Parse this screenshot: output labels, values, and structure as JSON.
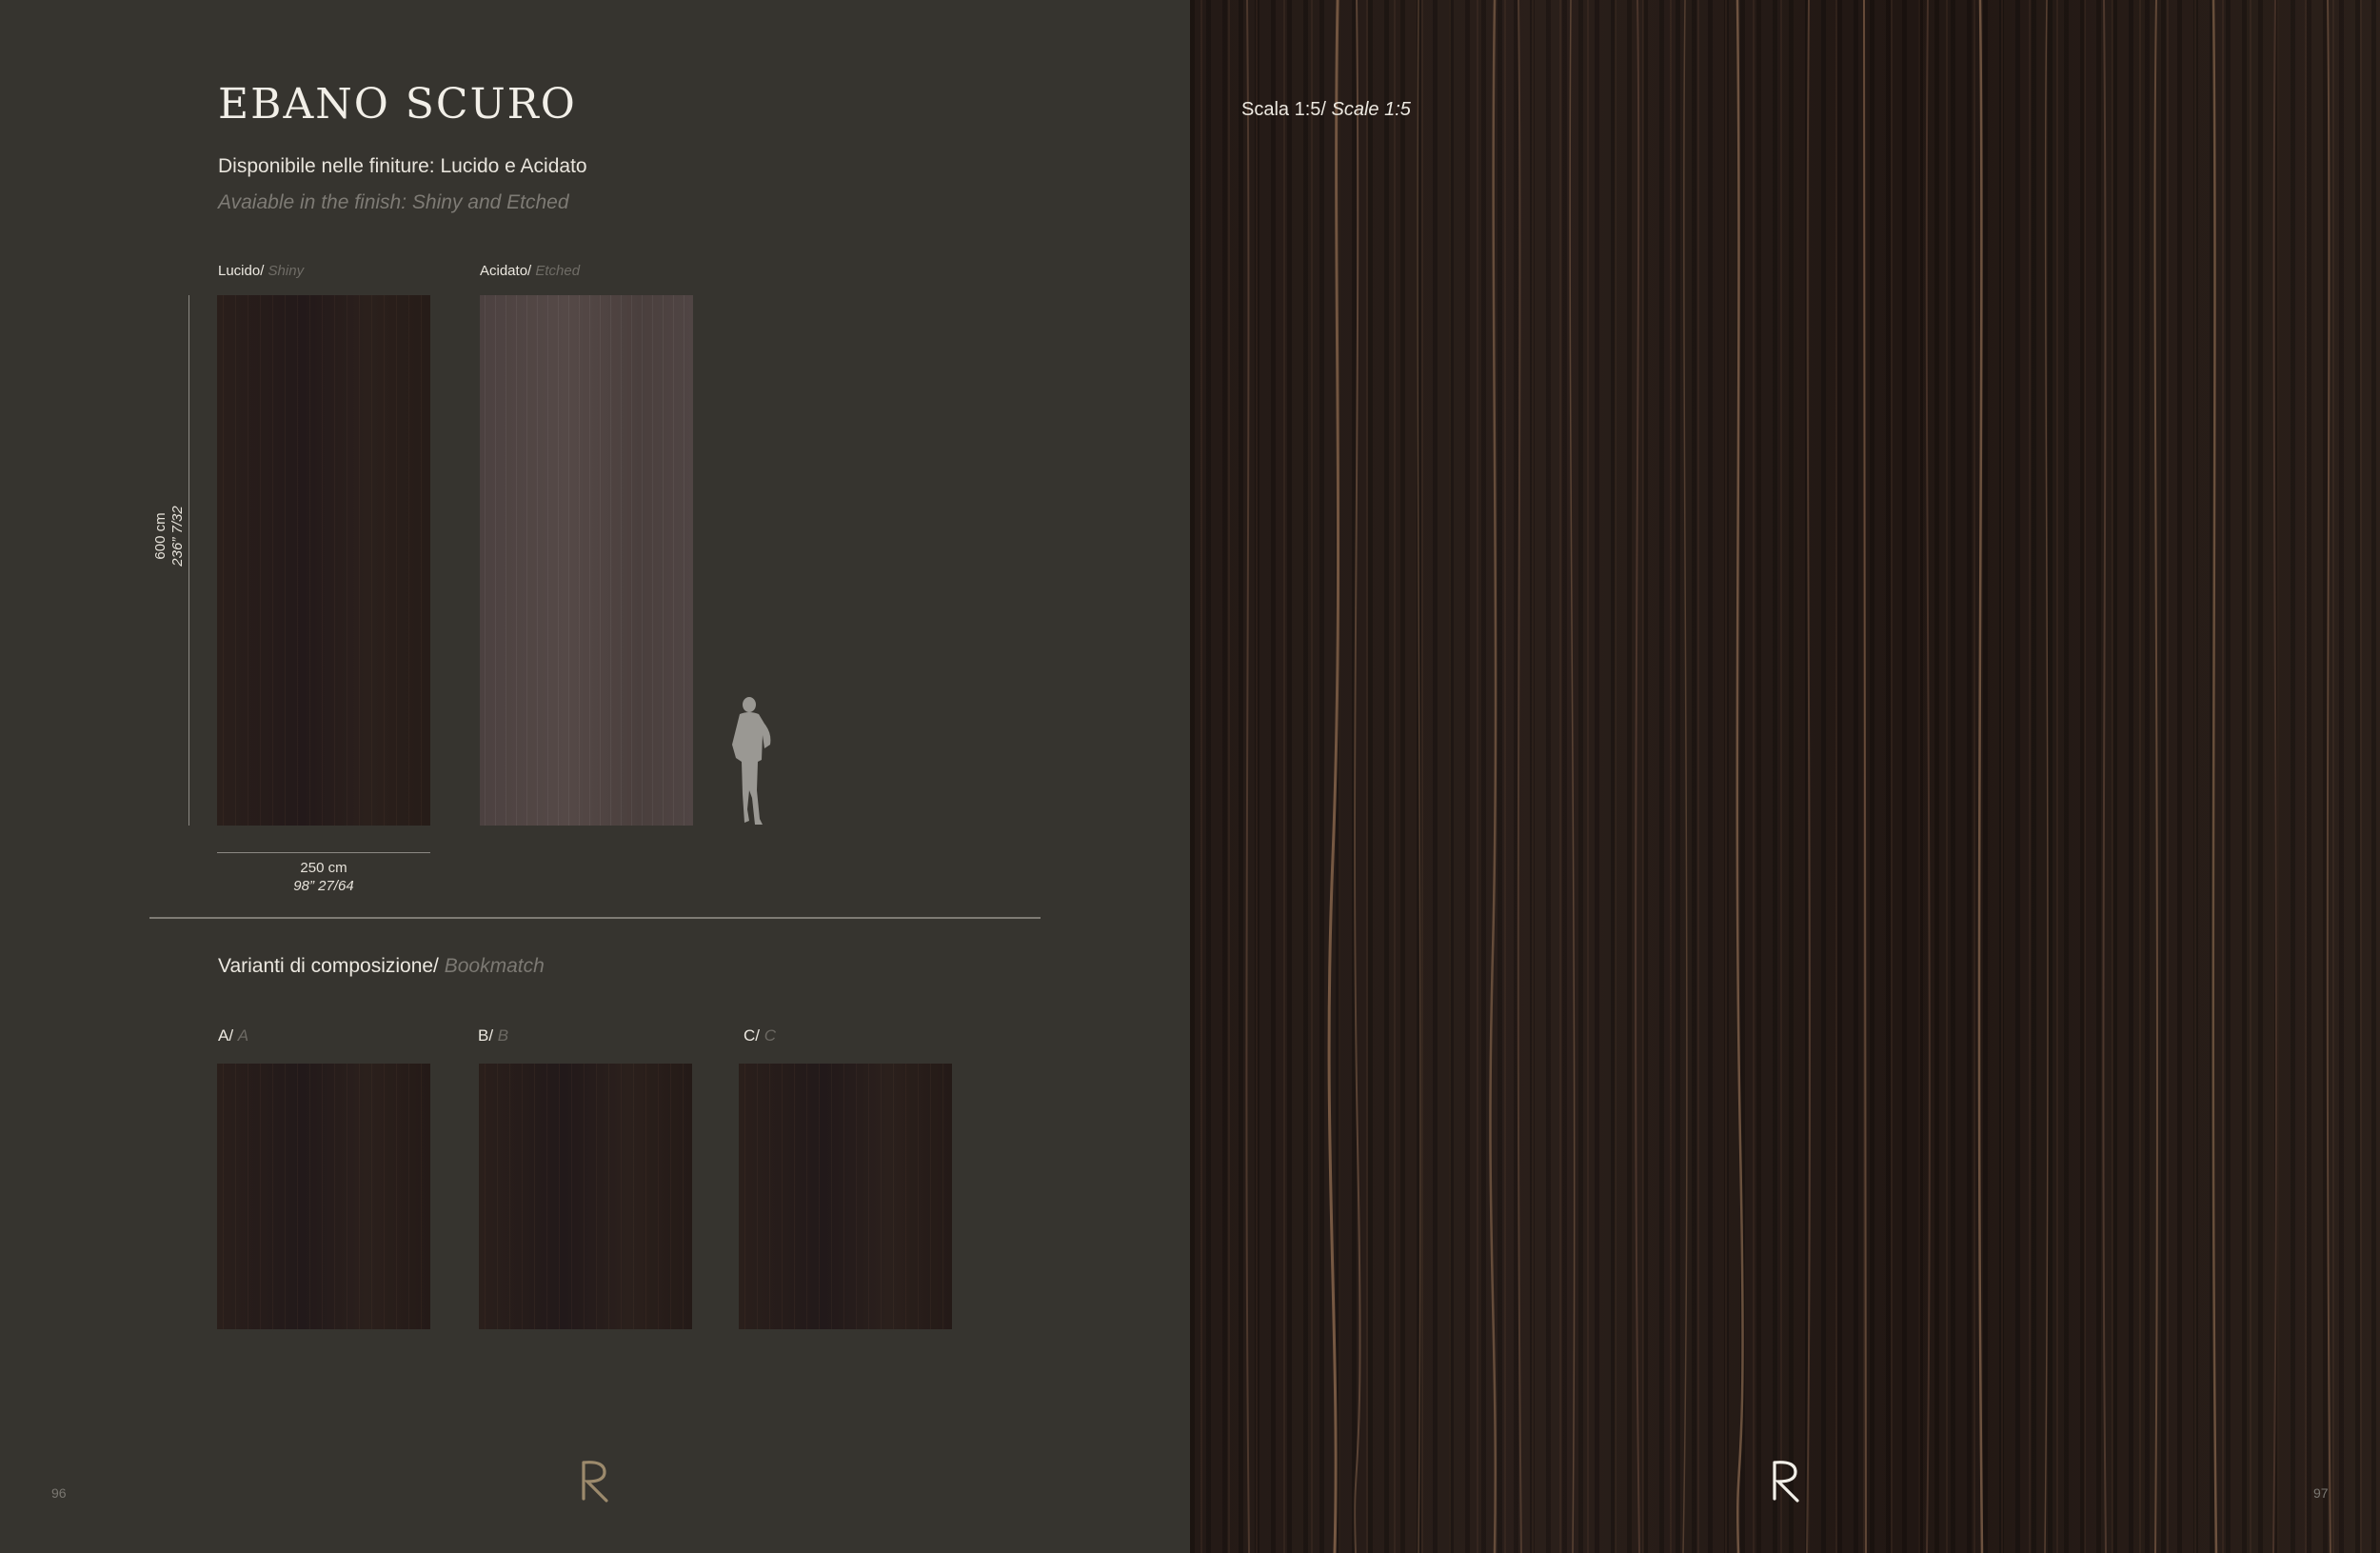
{
  "left_page": {
    "title": "EBANO SCURO",
    "subtitle_it": "Disponibile nelle finiture: Lucido e Acidato",
    "subtitle_en": "Avaiable in the finish: Shiny and Etched",
    "finishes": [
      {
        "label_it": "Lucido/",
        "label_en": "Shiny"
      },
      {
        "label_it": "Acidato/",
        "label_en": "Etched"
      }
    ],
    "height_dimension": {
      "metric": "600 cm",
      "imperial": "236” 7/32"
    },
    "width_dimension": {
      "metric": "250 cm",
      "imperial": "98” 27/64"
    },
    "section_title_it": "Varianti di composizione/",
    "section_title_en": "Bookmatch",
    "variants": [
      {
        "label_it": "A/",
        "label_en": "A"
      },
      {
        "label_it": "B/",
        "label_en": "B"
      },
      {
        "label_it": "C/",
        "label_en": "C"
      }
    ],
    "page_number": "96"
  },
  "right_page": {
    "scale_it": "Scala 1:5/",
    "scale_en": "Scale 1:5",
    "page_number": "97"
  },
  "icons": {
    "logo": "r-monogram-logo",
    "person": "person-silhouette-icon"
  },
  "colors": {
    "background": "#36342f",
    "wood_dark": "#2a1f1b",
    "wood_etched": "#504544",
    "logo_gold": "#9c8a6c"
  }
}
